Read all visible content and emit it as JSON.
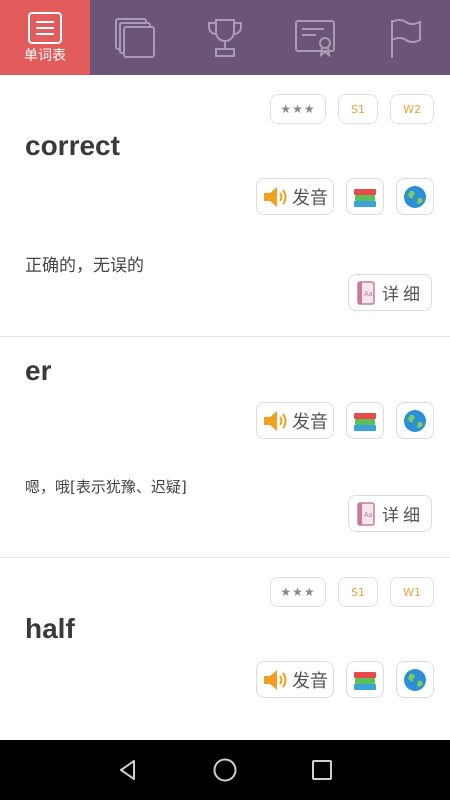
{
  "nav": {
    "tabs": [
      {
        "label": "单词表",
        "icon": "list-icon",
        "active": true
      },
      {
        "label": "",
        "icon": "cards-icon",
        "active": false
      },
      {
        "label": "",
        "icon": "trophy-icon",
        "active": false
      },
      {
        "label": "",
        "icon": "certificate-icon",
        "active": false
      },
      {
        "label": "",
        "icon": "flag-icon",
        "active": false
      }
    ]
  },
  "colors": {
    "nav_bg": "#6a5478",
    "nav_active": "#e35c5c",
    "tag_accent": "#e8a33a"
  },
  "words": [
    {
      "word": "correct",
      "stars": "★★★",
      "level": "S1",
      "rank": "W2",
      "pronounce_label": "发音",
      "meaning": "正确的，无误的",
      "detail_label": "详细"
    },
    {
      "word": "er",
      "pronounce_label": "发音",
      "meaning": "嗯，哦[表示犹豫、迟疑]",
      "detail_label": "详细"
    },
    {
      "word": "half",
      "stars": "★★★",
      "level": "S1",
      "rank": "W1",
      "pronounce_label": "发音"
    }
  ]
}
